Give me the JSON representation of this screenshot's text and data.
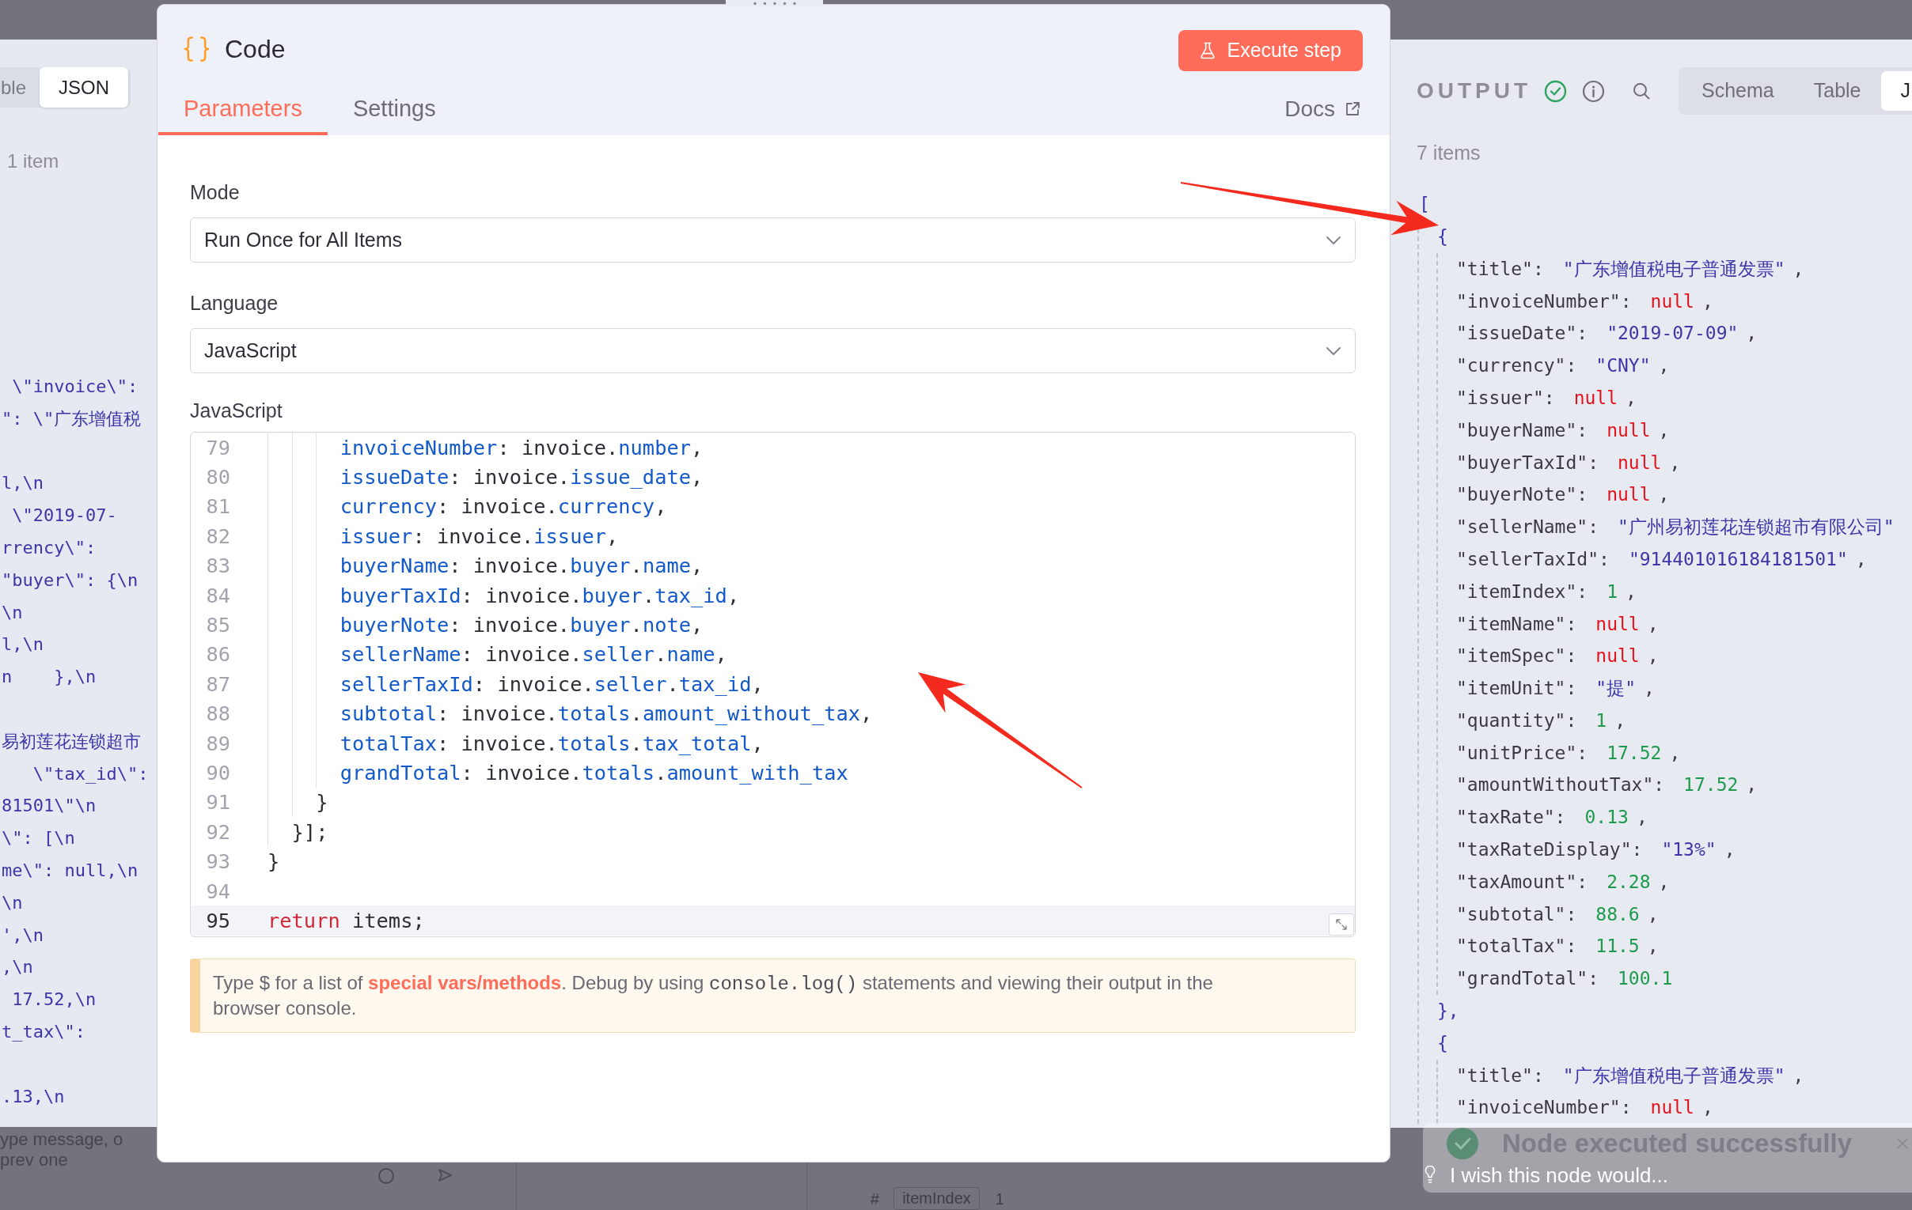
{
  "input_panel": {
    "view_tabs": [
      {
        "label": "ble",
        "selected": false
      },
      {
        "label": "JSON",
        "selected": true
      }
    ],
    "item_count": "1 item",
    "json_blocks": [
      [
        " \\\"invoice\\\":",
        "\": \\\"广东增值税"
      ],
      [
        "l,\\n",
        " \\\"2019-07-",
        "rrency\\\":",
        "\"buyer\\\": {\\n",
        "\\n",
        "l,\\n",
        "n    },\\n"
      ],
      [
        "易初莲花连锁超市",
        "   \\\"tax_id\\\":",
        "81501\\\"\\n",
        "\\\": [\\n",
        "me\\\": null,\\n",
        "\\n",
        "',\\n",
        ",\\n",
        " 17.52,\\n",
        "t_tax\\\":"
      ],
      [
        ".13,\\n"
      ]
    ]
  },
  "node": {
    "title": "Code",
    "execute_button": "Execute step",
    "tabs": [
      {
        "label": "Parameters",
        "selected": true
      },
      {
        "label": "Settings",
        "selected": false
      }
    ],
    "docs_link": "Docs",
    "fields": [
      {
        "label": "Mode",
        "kind": "select",
        "value": "Run Once for All Items"
      },
      {
        "label": "Language",
        "kind": "select",
        "value": "JavaScript"
      },
      {
        "label": "JavaScript",
        "kind": "code",
        "lines": [
          {
            "number": "79",
            "active": false,
            "tokens": [
              {
                "text": "      invoiceNumber",
                "kind": "property"
              },
              {
                "text": ": invoice.",
                "kind": "plain"
              },
              {
                "text": "number",
                "kind": "property"
              },
              {
                "text": ",",
                "kind": "plain"
              }
            ]
          },
          {
            "number": "80",
            "active": false,
            "tokens": [
              {
                "text": "      issueDate",
                "kind": "property"
              },
              {
                "text": ": invoice.",
                "kind": "plain"
              },
              {
                "text": "issue_date",
                "kind": "property"
              },
              {
                "text": ",",
                "kind": "plain"
              }
            ]
          },
          {
            "number": "81",
            "active": false,
            "tokens": [
              {
                "text": "      currency",
                "kind": "property"
              },
              {
                "text": ": invoice.",
                "kind": "plain"
              },
              {
                "text": "currency",
                "kind": "property"
              },
              {
                "text": ",",
                "kind": "plain"
              }
            ]
          },
          {
            "number": "82",
            "active": false,
            "tokens": [
              {
                "text": "      issuer",
                "kind": "property"
              },
              {
                "text": ": invoice.",
                "kind": "plain"
              },
              {
                "text": "issuer",
                "kind": "property"
              },
              {
                "text": ",",
                "kind": "plain"
              }
            ]
          },
          {
            "number": "83",
            "active": false,
            "tokens": [
              {
                "text": "      buyerName",
                "kind": "property"
              },
              {
                "text": ": invoice.",
                "kind": "plain"
              },
              {
                "text": "buyer",
                "kind": "property"
              },
              {
                "text": ".",
                "kind": "plain"
              },
              {
                "text": "name",
                "kind": "property"
              },
              {
                "text": ",",
                "kind": "plain"
              }
            ]
          },
          {
            "number": "84",
            "active": false,
            "tokens": [
              {
                "text": "      buyerTaxId",
                "kind": "property"
              },
              {
                "text": ": invoice.",
                "kind": "plain"
              },
              {
                "text": "buyer",
                "kind": "property"
              },
              {
                "text": ".",
                "kind": "plain"
              },
              {
                "text": "tax_id",
                "kind": "property"
              },
              {
                "text": ",",
                "kind": "plain"
              }
            ]
          },
          {
            "number": "85",
            "active": false,
            "tokens": [
              {
                "text": "      buyerNote",
                "kind": "property"
              },
              {
                "text": ": invoice.",
                "kind": "plain"
              },
              {
                "text": "buyer",
                "kind": "property"
              },
              {
                "text": ".",
                "kind": "plain"
              },
              {
                "text": "note",
                "kind": "property"
              },
              {
                "text": ",",
                "kind": "plain"
              }
            ]
          },
          {
            "number": "86",
            "active": false,
            "tokens": [
              {
                "text": "      sellerName",
                "kind": "property"
              },
              {
                "text": ": invoice.",
                "kind": "plain"
              },
              {
                "text": "seller",
                "kind": "property"
              },
              {
                "text": ".",
                "kind": "plain"
              },
              {
                "text": "name",
                "kind": "property"
              },
              {
                "text": ",",
                "kind": "plain"
              }
            ]
          },
          {
            "number": "87",
            "active": false,
            "tokens": [
              {
                "text": "      sellerTaxId",
                "kind": "property"
              },
              {
                "text": ": invoice.",
                "kind": "plain"
              },
              {
                "text": "seller",
                "kind": "property"
              },
              {
                "text": ".",
                "kind": "plain"
              },
              {
                "text": "tax_id",
                "kind": "property"
              },
              {
                "text": ",",
                "kind": "plain"
              }
            ]
          },
          {
            "number": "88",
            "active": false,
            "tokens": [
              {
                "text": "      subtotal",
                "kind": "property"
              },
              {
                "text": ": invoice.",
                "kind": "plain"
              },
              {
                "text": "totals",
                "kind": "property"
              },
              {
                "text": ".",
                "kind": "plain"
              },
              {
                "text": "amount_without_tax",
                "kind": "property"
              },
              {
                "text": ",",
                "kind": "plain"
              }
            ]
          },
          {
            "number": "89",
            "active": false,
            "tokens": [
              {
                "text": "      totalTax",
                "kind": "property"
              },
              {
                "text": ": invoice.",
                "kind": "plain"
              },
              {
                "text": "totals",
                "kind": "property"
              },
              {
                "text": ".",
                "kind": "plain"
              },
              {
                "text": "tax_total",
                "kind": "property"
              },
              {
                "text": ",",
                "kind": "plain"
              }
            ]
          },
          {
            "number": "90",
            "active": false,
            "tokens": [
              {
                "text": "      grandTotal",
                "kind": "property"
              },
              {
                "text": ": invoice.",
                "kind": "plain"
              },
              {
                "text": "totals",
                "kind": "property"
              },
              {
                "text": ".",
                "kind": "plain"
              },
              {
                "text": "amount_with_tax",
                "kind": "property"
              }
            ]
          },
          {
            "number": "91",
            "active": false,
            "tokens": [
              {
                "text": "    }",
                "kind": "plain"
              }
            ]
          },
          {
            "number": "92",
            "active": false,
            "tokens": [
              {
                "text": "  }];",
                "kind": "plain"
              }
            ]
          },
          {
            "number": "93",
            "active": false,
            "tokens": [
              {
                "text": "}",
                "kind": "plain"
              }
            ]
          },
          {
            "number": "94",
            "active": false
          },
          {
            "number": "95",
            "active": true,
            "tokens": [
              {
                "text": "return",
                "kind": "keyword"
              },
              {
                "text": " items;",
                "kind": "plain"
              }
            ]
          }
        ]
      }
    ],
    "hint": [
      {
        "text": "Type $ for a list of ",
        "kind": "text"
      },
      {
        "text": "special vars/methods",
        "kind": "link"
      },
      {
        "text": ". Debug by using ",
        "kind": "text"
      },
      {
        "text": "console.log()",
        "kind": "code"
      },
      {
        "text": " statements and viewing their output in the browser console.",
        "kind": "text"
      }
    ]
  },
  "output_panel": {
    "title": "OUTPUT",
    "view_tabs": [
      {
        "label": "Schema",
        "selected": false
      },
      {
        "label": "Table",
        "selected": false
      },
      {
        "label": "J",
        "selected": true
      }
    ],
    "item_count": "7 items",
    "json": {
      "open": "[",
      "objects": [
        {
          "open": "{",
          "close": "},",
          "fields": [
            {
              "key": "\"title\":",
              "value": "\"广东增值税电子普通发票\"",
              "kind": "string",
              "comma": ","
            },
            {
              "key": "\"invoiceNumber\":",
              "value": "null",
              "kind": "null",
              "comma": ","
            },
            {
              "key": "\"issueDate\":",
              "value": "\"2019-07-09\"",
              "kind": "string",
              "comma": ","
            },
            {
              "key": "\"currency\":",
              "value": "\"CNY\"",
              "kind": "string",
              "comma": ","
            },
            {
              "key": "\"issuer\":",
              "value": "null",
              "kind": "null",
              "comma": ","
            },
            {
              "key": "\"buyerName\":",
              "value": "null",
              "kind": "null",
              "comma": ","
            },
            {
              "key": "\"buyerTaxId\":",
              "value": "null",
              "kind": "null",
              "comma": ","
            },
            {
              "key": "\"buyerNote\":",
              "value": "null",
              "kind": "null",
              "comma": ","
            },
            {
              "key": "\"sellerName\":",
              "value": "\"广州易初莲花连锁超市有限公司\"",
              "kind": "string"
            },
            {
              "key": "\"sellerTaxId\":",
              "value": "\"914401016184181501\"",
              "kind": "string",
              "comma": ","
            },
            {
              "key": "\"itemIndex\":",
              "value": "1",
              "kind": "number",
              "comma": ","
            },
            {
              "key": "\"itemName\":",
              "value": "null",
              "kind": "null",
              "comma": ","
            },
            {
              "key": "\"itemSpec\":",
              "value": "null",
              "kind": "null",
              "comma": ","
            },
            {
              "key": "\"itemUnit\":",
              "value": "\"提\"",
              "kind": "string",
              "comma": ","
            },
            {
              "key": "\"quantity\":",
              "value": "1",
              "kind": "number",
              "comma": ","
            },
            {
              "key": "\"unitPrice\":",
              "value": "17.52",
              "kind": "number",
              "comma": ","
            },
            {
              "key": "\"amountWithoutTax\":",
              "value": "17.52",
              "kind": "number",
              "comma": ","
            },
            {
              "key": "\"taxRate\":",
              "value": "0.13",
              "kind": "number",
              "comma": ","
            },
            {
              "key": "\"taxRateDisplay\":",
              "value": "\"13%\"",
              "kind": "string",
              "comma": ","
            },
            {
              "key": "\"taxAmount\":",
              "value": "2.28",
              "kind": "number",
              "comma": ","
            },
            {
              "key": "\"subtotal\":",
              "value": "88.6",
              "kind": "number",
              "comma": ","
            },
            {
              "key": "\"totalTax\":",
              "value": "11.5",
              "kind": "number",
              "comma": ","
            },
            {
              "key": "\"grandTotal\":",
              "value": "100.1",
              "kind": "number"
            }
          ]
        },
        {
          "open": "{",
          "fields": [
            {
              "key": "\"title\":",
              "value": "\"广东增值税电子普通发票\"",
              "kind": "string",
              "comma": ","
            },
            {
              "key": "\"invoiceNumber\":",
              "value": "null",
              "kind": "null",
              "comma": ","
            }
          ]
        }
      ]
    }
  },
  "toast": {
    "message": "Node executed successfully",
    "feedback_prompt": "I wish this node would..."
  },
  "behind_overlay": {
    "chat_prompt_fragment": "ype message, o",
    "chat_hint_fragment": "prev one",
    "type_marker": "#",
    "column_label": "itemIndex",
    "cell_value": "1"
  }
}
